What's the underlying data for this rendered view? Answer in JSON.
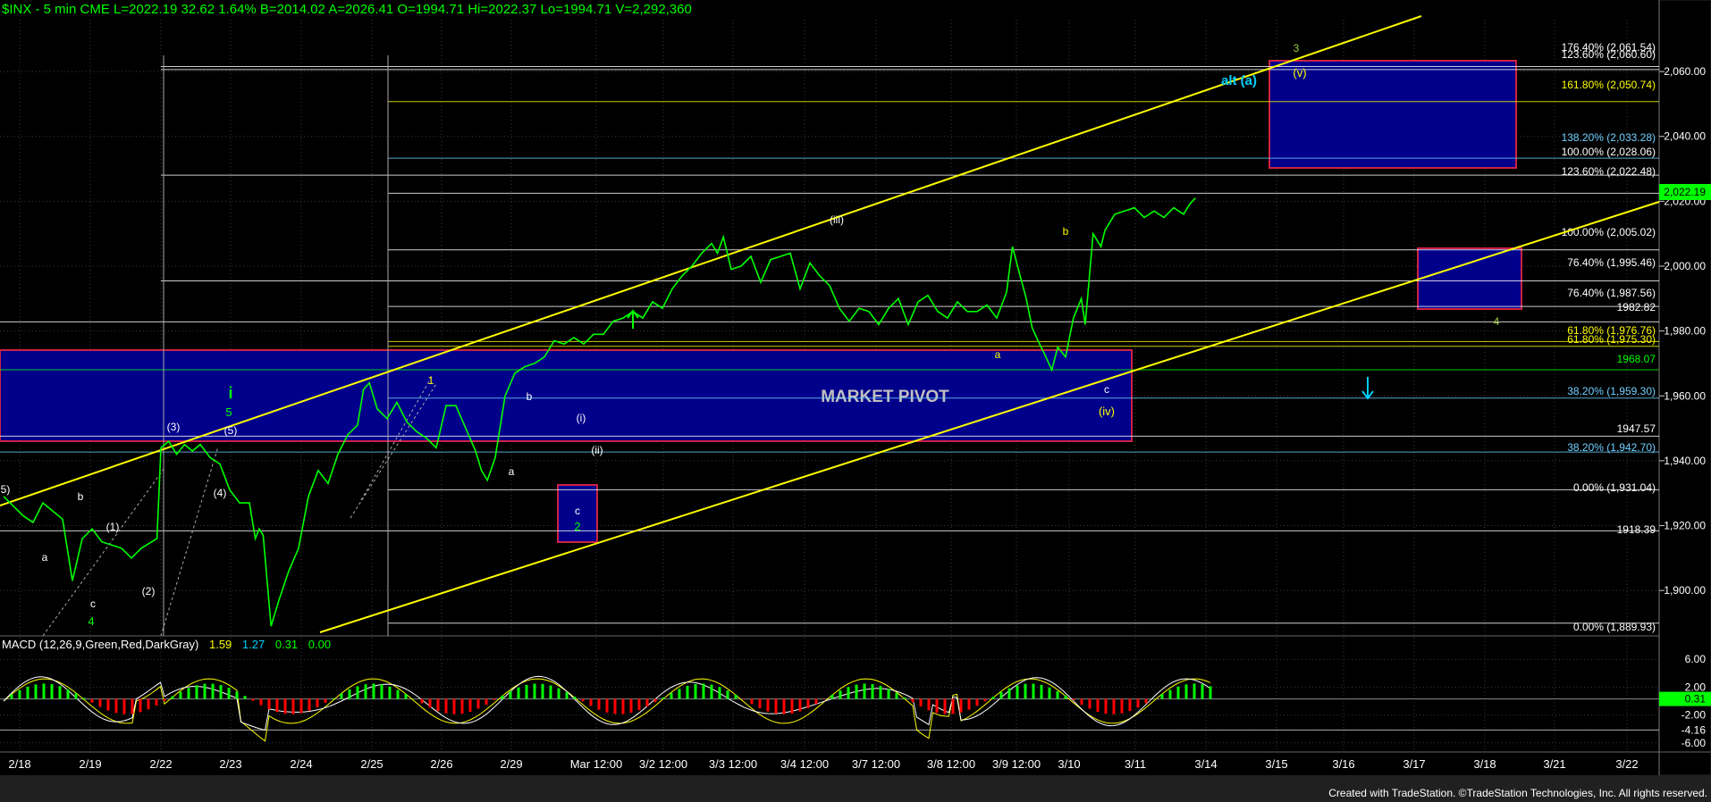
{
  "header": {
    "symbol_info": "$INX - 5 min  CME  L=2022.19  32.62  1.64%  B=2014.02  A=2026.41  O=1994.71  Hi=2022.37  Lo=1994.71  V=2,292,360"
  },
  "macd_header": {
    "name": "MACD (12,26,9,Green,Red,DarkGray)",
    "v1": "1.59",
    "v2": "1.27",
    "v3": "0.31",
    "v4": "0.00"
  },
  "credit": "Created with TradeStation. ©TradeStation Technologies, Inc. All rights reserved.",
  "chart_data": {
    "type": "line",
    "title": "",
    "ylim": [
      1886,
      2076
    ],
    "y_ticks": [
      "1,900.00",
      "1,920.00",
      "1,940.00",
      "1,960.00",
      "1,980.00",
      "2,000.00",
      "2,020.00",
      "2,040.00",
      "2,060.00"
    ],
    "x_ticks": [
      "2/18",
      "2/19",
      "2/22",
      "2/23",
      "2/24",
      "2/25",
      "2/26",
      "2/29",
      "Mar 12:00",
      "3/2 12:00",
      "3/3 12:00",
      "3/4 12:00",
      "3/7 12:00",
      "3/8 12:00",
      "3/9 12:00",
      "3/10",
      "3/11",
      "3/14",
      "3/15",
      "3/16",
      "3/17",
      "3/18",
      "3/21",
      "3/22"
    ],
    "last_price": "2,022.19",
    "series": [
      {
        "name": "",
        "color": "#00ff00",
        "points": [
          [
            0,
            1929
          ],
          [
            1,
            1923
          ],
          [
            1.5,
            1921
          ],
          [
            2,
            1927
          ],
          [
            3,
            1922
          ],
          [
            3.5,
            1903
          ],
          [
            4,
            1916
          ],
          [
            4.5,
            1919
          ],
          [
            5,
            1915
          ],
          [
            6,
            1913
          ],
          [
            6.5,
            1910
          ],
          [
            7,
            1913
          ],
          [
            7.8,
            1916
          ],
          [
            8,
            1944
          ],
          [
            8.4,
            1946
          ],
          [
            8.8,
            1942
          ],
          [
            9.2,
            1945
          ],
          [
            9.6,
            1943
          ],
          [
            10,
            1945
          ],
          [
            10.5,
            1941
          ],
          [
            11,
            1939
          ],
          [
            11.5,
            1931
          ],
          [
            12,
            1927
          ],
          [
            12.5,
            1927
          ],
          [
            12.8,
            1916
          ],
          [
            13,
            1919
          ],
          [
            13.2,
            1917
          ],
          [
            13.6,
            1889
          ],
          [
            14,
            1897
          ],
          [
            14.5,
            1906
          ],
          [
            15,
            1913
          ],
          [
            15.5,
            1929
          ],
          [
            16,
            1937
          ],
          [
            16.5,
            1933
          ],
          [
            17,
            1942
          ],
          [
            17.5,
            1948
          ],
          [
            18,
            1951
          ],
          [
            18.3,
            1962
          ],
          [
            18.6,
            1964
          ],
          [
            19,
            1956
          ],
          [
            19.5,
            1953
          ],
          [
            20,
            1958
          ],
          [
            20.5,
            1952
          ],
          [
            21,
            1949
          ],
          [
            21.5,
            1947
          ],
          [
            22,
            1944
          ],
          [
            22.5,
            1957
          ],
          [
            23,
            1957
          ],
          [
            23.5,
            1950
          ],
          [
            24,
            1943
          ],
          [
            24.3,
            1937
          ],
          [
            24.6,
            1934
          ],
          [
            25,
            1941
          ],
          [
            25.5,
            1960
          ],
          [
            26,
            1967
          ],
          [
            26.5,
            1969
          ],
          [
            27,
            1970
          ],
          [
            27.5,
            1972
          ],
          [
            28,
            1977
          ],
          [
            28.5,
            1976
          ],
          [
            29,
            1978
          ],
          [
            29.5,
            1976
          ],
          [
            30,
            1979
          ],
          [
            30.5,
            1979
          ],
          [
            31,
            1983
          ],
          [
            31.5,
            1984
          ],
          [
            32,
            1986
          ],
          [
            32.5,
            1984
          ],
          [
            33,
            1989
          ],
          [
            33.5,
            1987
          ],
          [
            34,
            1993
          ],
          [
            34.5,
            1997
          ],
          [
            35,
            2000
          ],
          [
            35.5,
            2004
          ],
          [
            36,
            2007
          ],
          [
            36.3,
            2004
          ],
          [
            36.6,
            2009
          ],
          [
            37,
            1999
          ],
          [
            37.5,
            2000
          ],
          [
            38,
            2003
          ],
          [
            38.5,
            1995
          ],
          [
            39,
            2002
          ],
          [
            39.5,
            2003
          ],
          [
            40,
            2004
          ],
          [
            40.5,
            1993
          ],
          [
            41,
            2001
          ],
          [
            41.5,
            1997
          ],
          [
            42,
            1994
          ],
          [
            42.5,
            1987
          ],
          [
            43,
            1983
          ],
          [
            43.5,
            1987
          ],
          [
            44,
            1986
          ],
          [
            44.5,
            1982
          ],
          [
            45,
            1987
          ],
          [
            45.5,
            1990
          ],
          [
            46,
            1982
          ],
          [
            46.5,
            1989
          ],
          [
            47,
            1991
          ],
          [
            47.5,
            1986
          ],
          [
            48,
            1984
          ],
          [
            48.5,
            1989
          ],
          [
            49,
            1986
          ],
          [
            49.5,
            1986
          ],
          [
            50,
            1988
          ],
          [
            50.5,
            1984
          ],
          [
            51,
            1992
          ],
          [
            51.3,
            2006
          ],
          [
            51.6,
            1999
          ],
          [
            52,
            1990
          ],
          [
            52.3,
            1981
          ],
          [
            52.6,
            1977
          ],
          [
            53,
            1972
          ],
          [
            53.3,
            1968
          ],
          [
            53.6,
            1975
          ],
          [
            54,
            1972
          ],
          [
            54.4,
            1984
          ],
          [
            54.8,
            1990
          ],
          [
            55,
            1982
          ],
          [
            55.4,
            2010
          ],
          [
            55.8,
            2006
          ],
          [
            56,
            2011
          ],
          [
            56.5,
            2016
          ],
          [
            57,
            2017
          ],
          [
            57.5,
            2018
          ],
          [
            58,
            2015
          ],
          [
            58.5,
            2017
          ],
          [
            59,
            2015
          ],
          [
            59.5,
            2018
          ],
          [
            60,
            2016
          ],
          [
            60.3,
            2019
          ],
          [
            60.6,
            2021
          ]
        ]
      }
    ],
    "horizontal_levels": [
      "176.40% (2,061.54)",
      "123.60% (2,060.60)",
      "161.80% (2,050.74)",
      "138.20% (2,033.28)",
      "100.00% (2,028.06)",
      "123.60% (2,022.48)",
      "100.00% (2,005.02)",
      "76.40% (1,995.46)",
      "76.40% (1,987.56)",
      "1982.82",
      "61.80% (1,976.76)",
      "61.80% (1,975.30)",
      "1968.07",
      "38.20% (1,959.30)",
      "1947.57",
      "38.20% (1,942.70)",
      "0.00% (1,931.04)",
      "1918.39",
      "0.00% (1,889.93)"
    ],
    "zones": [
      "MARKET PIVOT"
    ],
    "wave_labels": [
      "alt (a)",
      "(v)",
      "3",
      "4",
      "(iii)",
      "b",
      "a",
      "c",
      "(iv)",
      "1",
      "b",
      "a",
      "(i)",
      "(ii)",
      "c",
      "2",
      "i",
      "5",
      "(3)",
      "(5)",
      "(4)",
      "b",
      "(1)",
      "a",
      "c",
      "4",
      "(2)",
      "5)"
    ],
    "macd_axis": [
      "6.00",
      "2.00",
      "0.31",
      "-2.00",
      "-4.16",
      "-6.00"
    ]
  }
}
